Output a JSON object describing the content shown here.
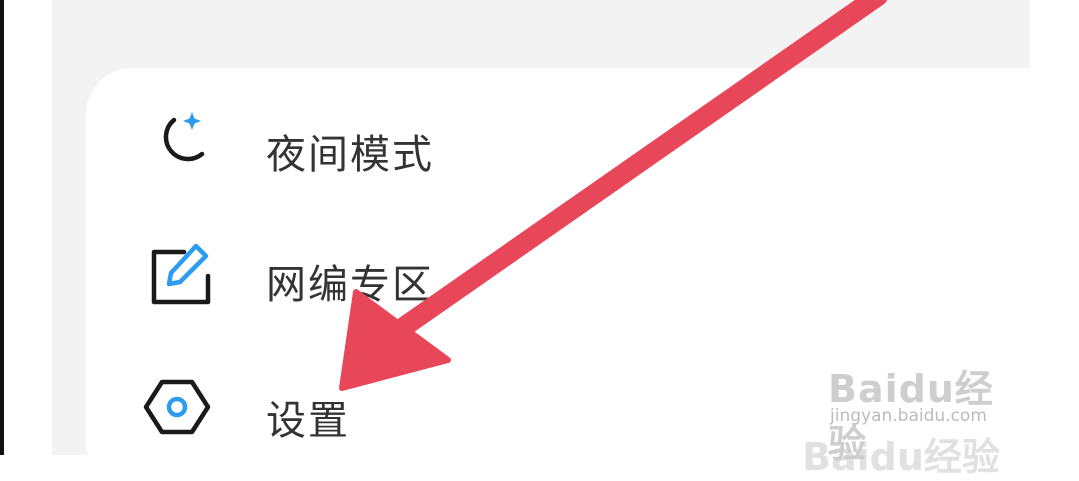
{
  "menu": {
    "items": [
      {
        "label": "夜间模式",
        "icon": "moon-star-icon"
      },
      {
        "label": "网编专区",
        "icon": "edit-square-icon"
      },
      {
        "label": "设置",
        "icon": "settings-hexagon-icon"
      }
    ]
  },
  "annotation": {
    "color": "#e8475a",
    "points_to": "设置"
  },
  "colors": {
    "icon_accent": "#2d9cf0",
    "icon_stroke": "#1a1a1a",
    "label_text": "#333333",
    "panel_bg": "#f3f3f3"
  },
  "watermark": {
    "logo": "Baidu经验",
    "url": "jingyan.baidu.com"
  }
}
